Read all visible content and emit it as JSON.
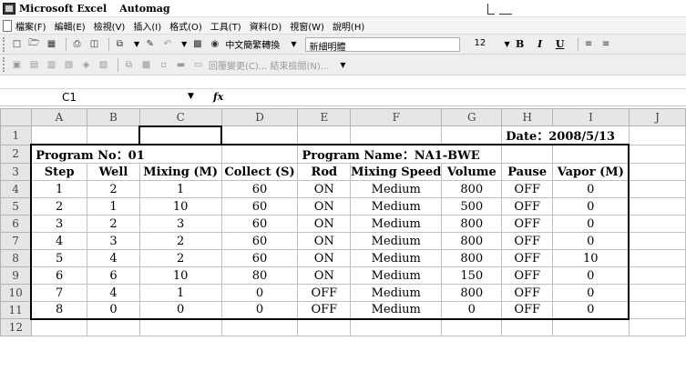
{
  "window": {
    "app_title": "Microsoft Excel",
    "doc_title": "Automag"
  },
  "menu": {
    "items": [
      "檔案(F)",
      "編輯(E)",
      "檢視(V)",
      "插入(I)",
      "格式(O)",
      "工具(T)",
      "資料(D)",
      "視窗(W)",
      "說明(H)"
    ]
  },
  "toolbar": {
    "translate_label": "中文簡繁轉換",
    "font_name": "新細明體",
    "font_size": "12",
    "bold_label": "B",
    "italic_label": "I",
    "underline_label": "U",
    "review_reply_label": "回覆變更(C)... 結束檢閱(N)..."
  },
  "formula_bar": {
    "name_box": "C1",
    "fx_label": "fx",
    "formula_value": ""
  },
  "grid": {
    "columns": [
      "A",
      "B",
      "C",
      "D",
      "E",
      "F",
      "G",
      "H",
      "I",
      "J"
    ],
    "rows": [
      "1",
      "2",
      "3",
      "4",
      "5",
      "6",
      "7",
      "8",
      "9",
      "10",
      "11",
      "12"
    ],
    "date_label": "Date：2008/5/13",
    "program_no_label": "Program No：01",
    "program_name_label": "Program Name：NA1-BWE",
    "headers": [
      "Step",
      "Well",
      "Mixing (M)",
      "Collect (S)",
      "Rod",
      "Mixing Speed",
      "Volume",
      "Pause",
      "Vapor (M)"
    ],
    "data_rows": [
      [
        "1",
        "2",
        "1",
        "60",
        "ON",
        "Medium",
        "800",
        "OFF",
        "0"
      ],
      [
        "2",
        "1",
        "10",
        "60",
        "ON",
        "Medium",
        "500",
        "OFF",
        "0"
      ],
      [
        "3",
        "2",
        "3",
        "60",
        "ON",
        "Medium",
        "800",
        "OFF",
        "0"
      ],
      [
        "4",
        "3",
        "2",
        "60",
        "ON",
        "Medium",
        "800",
        "OFF",
        "0"
      ],
      [
        "5",
        "4",
        "2",
        "60",
        "ON",
        "Medium",
        "800",
        "OFF",
        "10"
      ],
      [
        "6",
        "6",
        "10",
        "80",
        "ON",
        "Medium",
        "150",
        "OFF",
        "0"
      ],
      [
        "7",
        "4",
        "1",
        "0",
        "OFF",
        "Medium",
        "800",
        "OFF",
        "0"
      ],
      [
        "8",
        "0",
        "0",
        "0",
        "OFF",
        "Medium",
        "0",
        "OFF",
        "0"
      ]
    ]
  }
}
